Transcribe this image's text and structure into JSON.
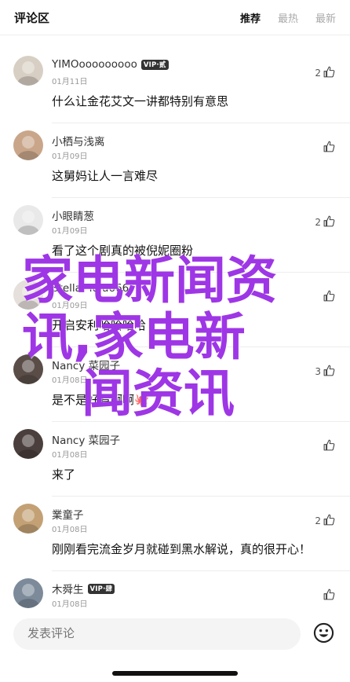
{
  "header": {
    "title": "评论区",
    "tabs": [
      {
        "label": "推荐",
        "active": true
      },
      {
        "label": "最热",
        "active": false
      },
      {
        "label": "最新",
        "active": false
      }
    ]
  },
  "comments": [
    {
      "name": "YIMOooooooooo",
      "badge": "VIP·贰",
      "date": "01月11日",
      "text": "什么让金花艾文一讲都特别有意思",
      "likes": "2",
      "avatar_color": "#d8cfc4"
    },
    {
      "name": "小栖与浅离",
      "badge": "",
      "date": "01月09日",
      "text": "这舅妈让人一言难尽",
      "likes": "",
      "avatar_color": "#c9a68a"
    },
    {
      "name": "小眼睛葱",
      "badge": "",
      "date": "01月09日",
      "text": "看了这个剧真的被倪妮圈粉",
      "likes": "2",
      "avatar_color": "#e9e9e9"
    },
    {
      "name": "Stellar lulu666",
      "badge": "",
      "date": "01月09日",
      "text": "开启安利哈哈哈哈",
      "likes": "",
      "avatar_color": "#e6e0dc"
    },
    {
      "name": "Nancy 菜园子",
      "badge": "",
      "date": "01月08日",
      "text": "是不是好看啊啊🐙",
      "likes": "3",
      "avatar_color": "#5a4d48"
    },
    {
      "name": "Nancy 菜园子",
      "badge": "",
      "date": "01月08日",
      "text": "来了",
      "likes": "",
      "avatar_color": "#4a3f3c"
    },
    {
      "name": "業童子",
      "badge": "",
      "date": "01月08日",
      "text": "刚刚看完流金岁月就碰到黑水解说，真的很开心！",
      "likes": "2",
      "avatar_color": "#c3a175"
    },
    {
      "name": "木舜生",
      "badge": "VIP·肆",
      "date": "01月08日",
      "text": "",
      "likes": "",
      "avatar_color": "#7c8a9a"
    }
  ],
  "overlay": {
    "line1": "家电新闻资",
    "line2": "讯,家电新",
    "line3": "闻资讯"
  },
  "input": {
    "placeholder": "发表评论"
  },
  "icons": {
    "like": "thumbs-up-icon",
    "emoji": "emoji-icon"
  }
}
